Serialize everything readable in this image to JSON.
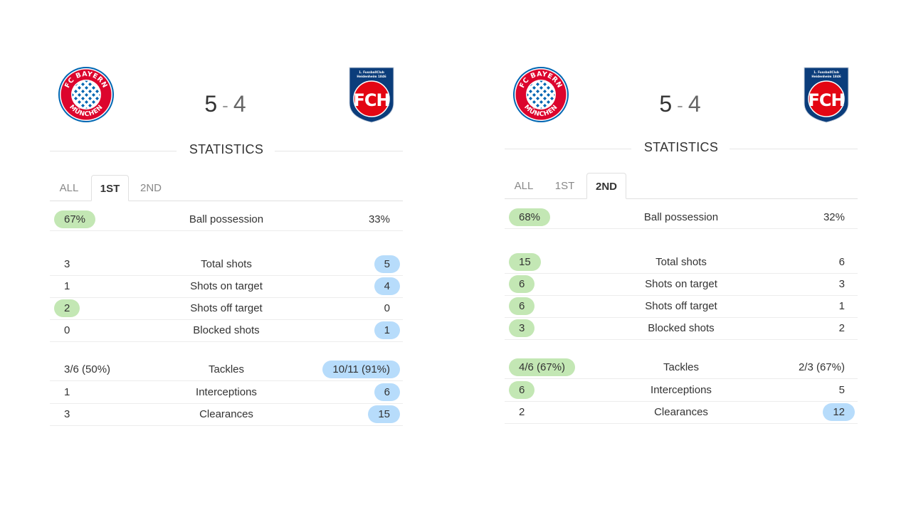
{
  "colors": {
    "home_highlight": "#c3e7b4",
    "away_highlight": "#b7dcfb"
  },
  "panels": [
    {
      "home_team": {
        "logo": "fc-bayern-munchen-logo",
        "logo_text_top": "FC BAYERN",
        "logo_text_bottom": "MÜNCHEN"
      },
      "away_team": {
        "logo": "fc-heidenheim-logo",
        "logo_text": "FCH",
        "logo_subtext": "1. FussballClub Heidenheim 1846"
      },
      "score": {
        "home": "5",
        "separator": "-",
        "away": "4"
      },
      "section_title": "STATISTICS",
      "tabs": [
        {
          "label": "ALL",
          "active": false
        },
        {
          "label": "1ST",
          "active": true
        },
        {
          "label": "2ND",
          "active": false
        }
      ],
      "possession": {
        "label": "Ball possession",
        "home": "67%",
        "away": "33%",
        "highlight": "home"
      },
      "shots": [
        {
          "label": "Total shots",
          "home": "3",
          "away": "5",
          "highlight": "away"
        },
        {
          "label": "Shots on target",
          "home": "1",
          "away": "4",
          "highlight": "away"
        },
        {
          "label": "Shots off target",
          "home": "2",
          "away": "0",
          "highlight": "home"
        },
        {
          "label": "Blocked shots",
          "home": "0",
          "away": "1",
          "highlight": "away"
        }
      ],
      "defense": [
        {
          "label": "Tackles",
          "home": "3/6 (50%)",
          "away": "10/11 (91%)",
          "highlight": "away"
        },
        {
          "label": "Interceptions",
          "home": "1",
          "away": "6",
          "highlight": "away"
        },
        {
          "label": "Clearances",
          "home": "3",
          "away": "15",
          "highlight": "away"
        }
      ]
    },
    {
      "home_team": {
        "logo": "fc-bayern-munchen-logo",
        "logo_text_top": "FC BAYERN",
        "logo_text_bottom": "MÜNCHEN"
      },
      "away_team": {
        "logo": "fc-heidenheim-logo",
        "logo_text": "FCH",
        "logo_subtext": "1. FussballClub Heidenheim 1846"
      },
      "score": {
        "home": "5",
        "separator": "-",
        "away": "4"
      },
      "section_title": "STATISTICS",
      "tabs": [
        {
          "label": "ALL",
          "active": false
        },
        {
          "label": "1ST",
          "active": false
        },
        {
          "label": "2ND",
          "active": true
        }
      ],
      "possession": {
        "label": "Ball possession",
        "home": "68%",
        "away": "32%",
        "highlight": "home"
      },
      "shots": [
        {
          "label": "Total shots",
          "home": "15",
          "away": "6",
          "highlight": "home"
        },
        {
          "label": "Shots on target",
          "home": "6",
          "away": "3",
          "highlight": "home"
        },
        {
          "label": "Shots off target",
          "home": "6",
          "away": "1",
          "highlight": "home"
        },
        {
          "label": "Blocked shots",
          "home": "3",
          "away": "2",
          "highlight": "home"
        }
      ],
      "defense": [
        {
          "label": "Tackles",
          "home": "4/6 (67%)",
          "away": "2/3 (67%)",
          "highlight": "home"
        },
        {
          "label": "Interceptions",
          "home": "6",
          "away": "5",
          "highlight": "home"
        },
        {
          "label": "Clearances",
          "home": "2",
          "away": "12",
          "highlight": "away"
        }
      ]
    }
  ]
}
